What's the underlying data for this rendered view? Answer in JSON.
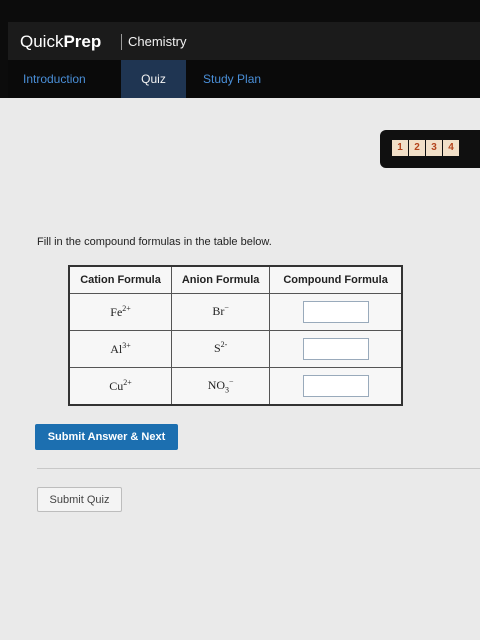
{
  "app": {
    "brand_quick": "Quick",
    "brand_prep": "Prep",
    "subject": "Chemistry"
  },
  "nav": {
    "tabs": [
      {
        "label": "Introduction"
      },
      {
        "label": "Quiz",
        "active": true
      },
      {
        "label": "Study Plan"
      }
    ]
  },
  "question_pages": [
    "1",
    "2",
    "3",
    "4"
  ],
  "question": {
    "instructions": "Fill in the compound formulas in the table below.",
    "headers": [
      "Cation Formula",
      "Anion Formula",
      "Compound Formula"
    ],
    "rows": [
      {
        "cation": "Fe",
        "cation_charge": "2+",
        "anion": "Br",
        "anion_sub": "",
        "anion_charge": "−",
        "compound": ""
      },
      {
        "cation": "Al",
        "cation_charge": "3+",
        "anion": "S",
        "anion_sub": "",
        "anion_charge": "2-",
        "compound": ""
      },
      {
        "cation": "Cu",
        "cation_charge": "2+",
        "anion": "NO",
        "anion_sub": "3",
        "anion_charge": "−",
        "compound": ""
      }
    ]
  },
  "actions": {
    "submit_answer_next": "Submit Answer & Next",
    "submit_quiz": "Submit Quiz"
  },
  "colors": {
    "accent_blue": "#1c6fb0",
    "nav_link": "#4a8fd8",
    "active_tab": "#1f3552"
  }
}
